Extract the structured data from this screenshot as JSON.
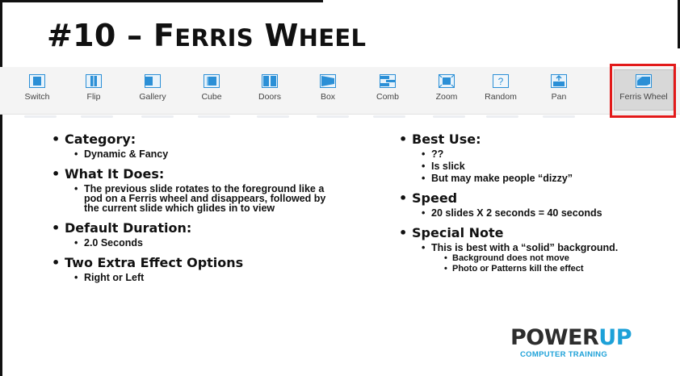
{
  "slide": {
    "title_number": "#10 –",
    "title_words": [
      {
        "initial": "F",
        "rest": "ERRIS"
      },
      {
        "initial": "W",
        "rest": "HEEL"
      }
    ]
  },
  "ribbon": {
    "items": [
      {
        "label": "Switch",
        "icon": "switch-icon"
      },
      {
        "label": "Flip",
        "icon": "flip-icon"
      },
      {
        "label": "Gallery",
        "icon": "gallery-icon"
      },
      {
        "label": "Cube",
        "icon": "cube-icon"
      },
      {
        "label": "Doors",
        "icon": "doors-icon"
      },
      {
        "label": "Box",
        "icon": "box-icon"
      },
      {
        "label": "Comb",
        "icon": "comb-icon"
      },
      {
        "label": "Zoom",
        "icon": "zoom-icon"
      },
      {
        "label": "Random",
        "icon": "random-icon",
        "glyph": "?"
      },
      {
        "label": "Pan",
        "icon": "pan-icon"
      },
      {
        "label": "Ferris Wheel",
        "icon": "ferris-wheel-icon",
        "selected": true
      }
    ],
    "highlight_color": "#e21a1a",
    "icon_color": "#2b8fd6"
  },
  "left_column": {
    "category_heading": "Category:",
    "category_value": "Dynamic & Fancy",
    "what_heading": "What It Does:",
    "what_value": "The previous slide rotates to the foreground like a pod on a Ferris wheel and disappears, followed by the current slide which glides in to view",
    "duration_heading": "Default Duration:",
    "duration_value": "2.0 Seconds",
    "options_heading": "Two Extra Effect Options",
    "options_value": "Right or Left"
  },
  "right_column": {
    "best_heading": "Best Use:",
    "best_items": [
      "??",
      "Is slick",
      "But may make people “dizzy”"
    ],
    "speed_heading": "Speed",
    "speed_value": "20 slides X 2 seconds = 40 seconds",
    "note_heading": "Special Note",
    "note_value": "This is best with a “solid” background.",
    "note_subitems": [
      "Background does not move",
      "Photo or Patterns kill the effect"
    ]
  },
  "logo": {
    "part1": "POWER",
    "part2": "UP",
    "subtitle": "COMPUTER TRAINING",
    "dark_color": "#2d2d2d",
    "accent_color": "#1da1d8"
  }
}
